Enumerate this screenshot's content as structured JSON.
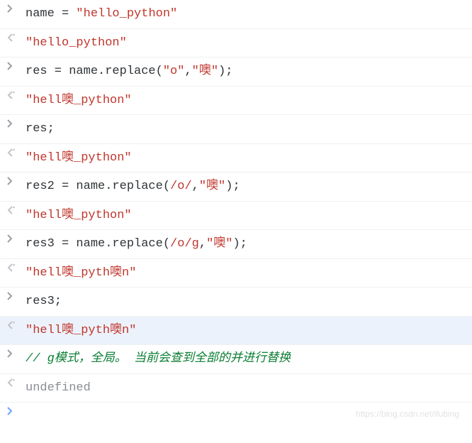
{
  "watermark": "https://blog.csdn.net/ifubing",
  "lines": [
    {
      "dir": "in",
      "segments": [
        {
          "cls": "plain",
          "t": "name = "
        },
        {
          "cls": "string",
          "t": "\"hello_python\""
        }
      ]
    },
    {
      "dir": "out",
      "segments": [
        {
          "cls": "string",
          "t": "\"hello_python\""
        }
      ]
    },
    {
      "dir": "in",
      "segments": [
        {
          "cls": "plain",
          "t": "res = name.replace("
        },
        {
          "cls": "string",
          "t": "\"o\""
        },
        {
          "cls": "plain",
          "t": ","
        },
        {
          "cls": "string",
          "t": "\"噢\""
        },
        {
          "cls": "plain",
          "t": ");"
        }
      ]
    },
    {
      "dir": "out",
      "segments": [
        {
          "cls": "string",
          "t": "\"hell噢_python\""
        }
      ]
    },
    {
      "dir": "in",
      "segments": [
        {
          "cls": "plain",
          "t": "res;"
        }
      ]
    },
    {
      "dir": "out",
      "segments": [
        {
          "cls": "string",
          "t": "\"hell噢_python\""
        }
      ]
    },
    {
      "dir": "in",
      "segments": [
        {
          "cls": "plain",
          "t": "res2 = name.replace("
        },
        {
          "cls": "regex",
          "t": "/o/"
        },
        {
          "cls": "plain",
          "t": ","
        },
        {
          "cls": "string",
          "t": "\"噢\""
        },
        {
          "cls": "plain",
          "t": ");"
        }
      ]
    },
    {
      "dir": "out",
      "segments": [
        {
          "cls": "string",
          "t": "\"hell噢_python\""
        }
      ]
    },
    {
      "dir": "in",
      "segments": [
        {
          "cls": "plain",
          "t": "res3 = name.replace("
        },
        {
          "cls": "regex",
          "t": "/o/g"
        },
        {
          "cls": "plain",
          "t": ","
        },
        {
          "cls": "string",
          "t": "\"噢\""
        },
        {
          "cls": "plain",
          "t": ");"
        }
      ]
    },
    {
      "dir": "out",
      "segments": [
        {
          "cls": "string",
          "t": "\"hell噢_pyth噢n\""
        }
      ]
    },
    {
      "dir": "in",
      "segments": [
        {
          "cls": "plain",
          "t": "res3;"
        }
      ]
    },
    {
      "dir": "out",
      "highlight": true,
      "segments": [
        {
          "cls": "string",
          "t": "\"hell噢_pyth噢n\""
        }
      ]
    },
    {
      "dir": "in",
      "segments": [
        {
          "cls": "comment",
          "t": "// g模式，全局。 当前会查到全部的并进行替换"
        }
      ]
    },
    {
      "dir": "out",
      "segments": [
        {
          "cls": "undef",
          "t": "undefined"
        }
      ]
    }
  ]
}
